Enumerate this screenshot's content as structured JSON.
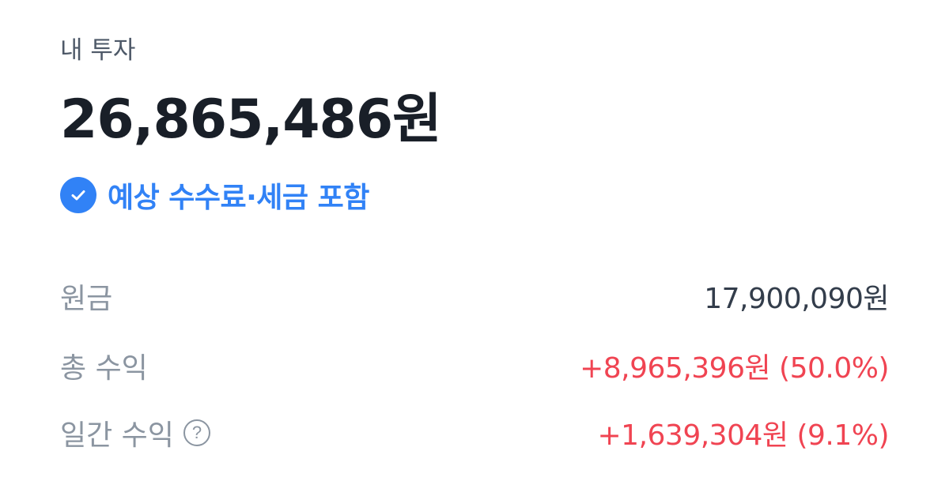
{
  "section": {
    "title": "내 투자"
  },
  "summary": {
    "total_amount": "26,865,486원",
    "fee_note": "예상 수수료·세금 포함",
    "fee_note_icon": "check-circle-icon"
  },
  "rows": [
    {
      "label": "원금",
      "value": "17,900,090원"
    },
    {
      "label": "총 수익",
      "value": "+8,965,396원 (50.0%)"
    },
    {
      "label": "일간 수익",
      "value": "+1,639,304원 (9.1%)",
      "help_icon": "?"
    }
  ],
  "colors": {
    "accent": "#3182f6",
    "positive": "#f04452",
    "label": "#8b95a1",
    "title": "#4e5968",
    "amount": "#191f28"
  }
}
